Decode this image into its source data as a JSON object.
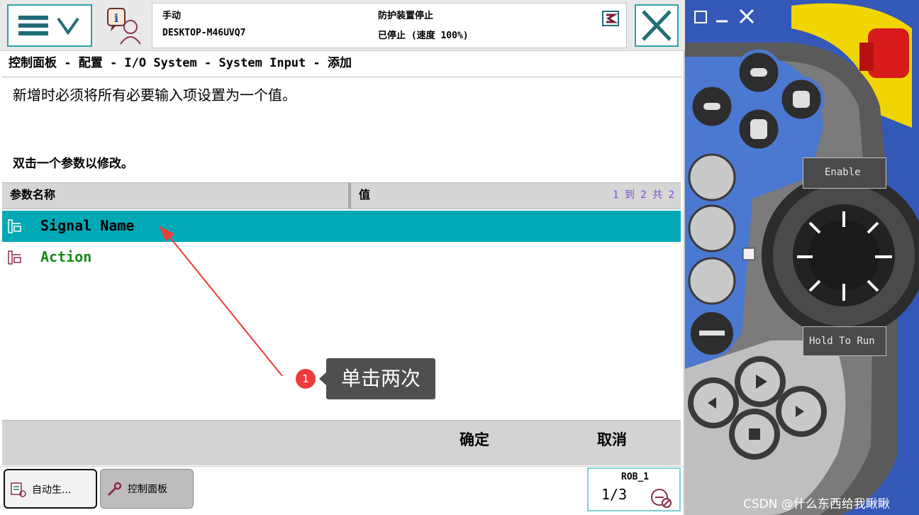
{
  "header": {
    "mode": "手动",
    "controller": "DESKTOP-M46UVQ7",
    "state": "防护装置停止",
    "speed_status": "已停止 (速度 100%)"
  },
  "breadcrumb": "控制面板 - 配置 - I/O System - System Input - 添加",
  "messages": {
    "required_note": "新增时必须将所有必要输入项设置为一个值。",
    "instruction": "双击一个参数以修改。"
  },
  "table": {
    "columns": [
      "参数名称",
      "值"
    ],
    "count": "1 到 2 共 2",
    "rows": [
      {
        "name": "Signal Name",
        "value": ""
      },
      {
        "name": "Action",
        "value": ""
      }
    ]
  },
  "actions": {
    "ok_label": "确定",
    "cancel_label": "取消"
  },
  "taskbar": {
    "task1_label": "自动生...",
    "task2_label": "控制面板",
    "robot": "ROB_1",
    "speed_fraction": "1/3"
  },
  "annotation": {
    "step": "1",
    "text": "单击两次"
  },
  "pendant": {
    "enable_label": "Enable",
    "hold_label": "Hold To Run"
  },
  "watermark": "CSDN @什么东西给我瞅瞅",
  "colors": {
    "accent": "#2aa3a6",
    "selected_row": "#00a9b5",
    "action_text": "#1a8a1a",
    "count_text": "#7b4be0",
    "pendant_blue": "#3458b8",
    "badge_red": "#ee3b3b"
  }
}
